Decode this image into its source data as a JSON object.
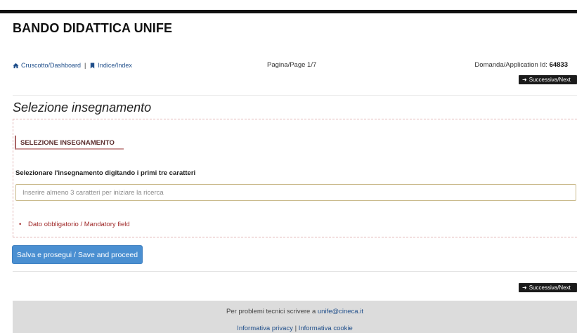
{
  "app": {
    "title": "BANDO DIDATTICA UNIFE"
  },
  "nav": {
    "dashboard": "Cruscotto/Dashboard",
    "separator": "|",
    "index": "Indice/Index",
    "page": "Pagina/Page 1/7",
    "application_label": "Domanda/Application Id:",
    "application_id": "64833",
    "next_label": "Successiva/Next",
    "icons": {
      "dashboard": "home-icon",
      "index": "bookmark-icon",
      "next": "arrow-right-icon"
    }
  },
  "section": {
    "title": "Selezione insegnamento",
    "subheader": "SELEZIONE INSEGNAMENTO",
    "field_label": "Selezionare l'insegnamento digitando i primi tre caratteri",
    "search_placeholder": "Inserire almeno 3 caratteri per iniziare la ricerca",
    "search_value": "",
    "mandatory_bullet": "•",
    "mandatory_note": "Dato obbligatorio / Mandatory field"
  },
  "actions": {
    "save_label": "Salva e prosegui / Save and proceed"
  },
  "footer": {
    "support_text": "Per problemi tecnici scrivere a ",
    "support_email": "unife@cineca.it",
    "privacy": "Informativa privacy",
    "separator": "|",
    "cookie": "Informativa cookie"
  },
  "colors": {
    "primary_button": "#4a8fd1",
    "next_button": "#1b1b1b",
    "link": "#1f4e8a",
    "mandatory": "#a02a2a",
    "footer_bg": "#dcdcdc"
  }
}
